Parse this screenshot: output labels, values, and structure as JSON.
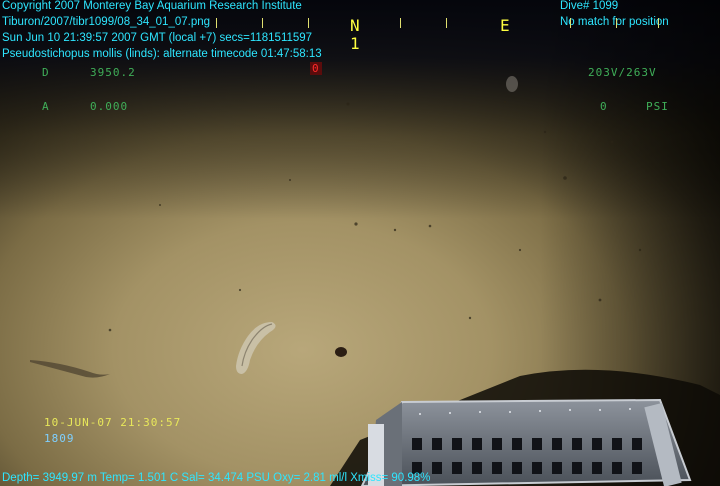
{
  "header": {
    "copyright": "Copyright 2007 Monterey Bay Aquarium Research Institute",
    "filename": "Tiburon/2007/tibr1099/08_34_01_07.png",
    "datetime": "Sun Jun 10 21:39:57 2007 GMT (local +7)  secs=1181511597",
    "annotation": "Pseudostichopus mollis (linds): alternate timecode 01:47:58:13",
    "dive": "Dive# 1099",
    "position": "No match for position"
  },
  "compass": {
    "north": "N",
    "east": "E",
    "heading_digit": "1"
  },
  "camera_overlay": {
    "depth_label": "D",
    "depth_value": "3950.2",
    "altitude_label": "A",
    "altitude_value": "0.000",
    "voltage": "203V/263V",
    "pressure_label": "0",
    "pressure_unit": "PSI",
    "rec_indicator": "0",
    "timestamp": "10-JUN-07 21:30:57",
    "frame_id": "1809"
  },
  "footer": {
    "sensor_line": "Depth= 3949.97 m  Temp= 1.501 C  Sal= 34.474 PSU  Oxy= 2.81 ml/l  Xmiss= 90.98%"
  },
  "colors": {
    "overlay_text": "#2ee6ff",
    "camera_text": "#3fae58",
    "compass": "#ffff40",
    "seafloor": "#a89868"
  }
}
